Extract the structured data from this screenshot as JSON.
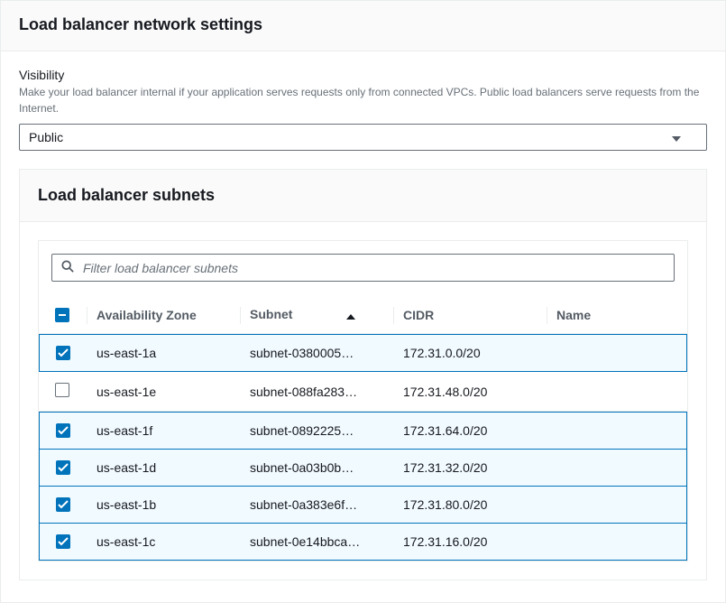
{
  "header": {
    "title": "Load balancer network settings"
  },
  "visibility": {
    "label": "Visibility",
    "description": "Make your load balancer internal if your application serves requests only from connected VPCs. Public load balancers serve requests from the Internet.",
    "selected": "Public"
  },
  "subnets": {
    "title": "Load balancer subnets",
    "filter_placeholder": "Filter load balancer subnets",
    "columns": {
      "az": "Availability Zone",
      "subnet": "Subnet",
      "cidr": "CIDR",
      "name": "Name"
    },
    "rows": [
      {
        "selected": true,
        "az": "us-east-1a",
        "subnet": "subnet-0380005…",
        "cidr": "172.31.0.0/20",
        "name": ""
      },
      {
        "selected": false,
        "az": "us-east-1e",
        "subnet": "subnet-088fa283…",
        "cidr": "172.31.48.0/20",
        "name": ""
      },
      {
        "selected": true,
        "az": "us-east-1f",
        "subnet": "subnet-0892225…",
        "cidr": "172.31.64.0/20",
        "name": ""
      },
      {
        "selected": true,
        "az": "us-east-1d",
        "subnet": "subnet-0a03b0b…",
        "cidr": "172.31.32.0/20",
        "name": ""
      },
      {
        "selected": true,
        "az": "us-east-1b",
        "subnet": "subnet-0a383e6f…",
        "cidr": "172.31.80.0/20",
        "name": ""
      },
      {
        "selected": true,
        "az": "us-east-1c",
        "subnet": "subnet-0e14bbca…",
        "cidr": "172.31.16.0/20",
        "name": ""
      }
    ]
  }
}
